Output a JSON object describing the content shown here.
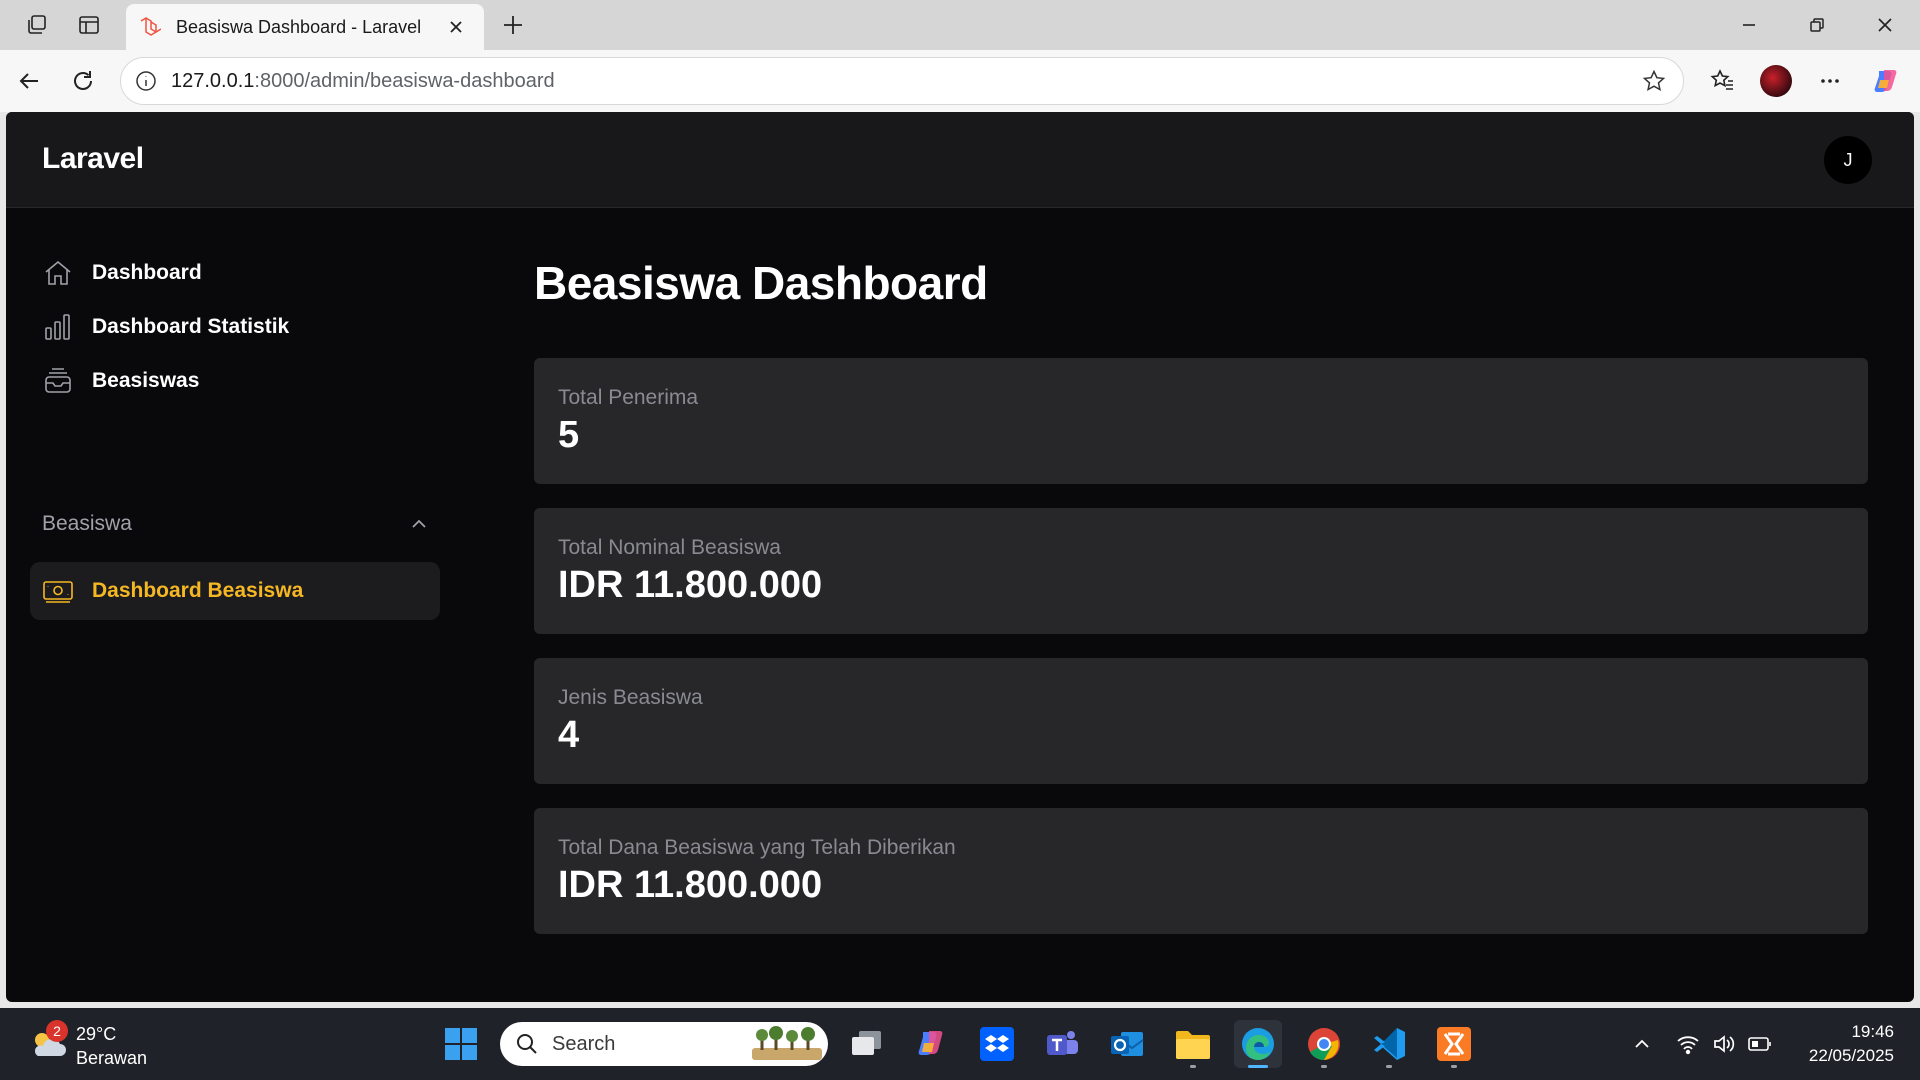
{
  "browser": {
    "tab_title": "Beasiswa Dashboard - Laravel",
    "url_host": "127.0.0.1",
    "url_rest": ":8000/admin/beasiswa-dashboard"
  },
  "app": {
    "brand": "Laravel",
    "avatar_initial": "J"
  },
  "sidebar": {
    "items": [
      {
        "label": "Dashboard",
        "icon": "home-icon"
      },
      {
        "label": "Dashboard Statistik",
        "icon": "bar-chart-icon"
      },
      {
        "label": "Beasiswas",
        "icon": "inbox-stack-icon"
      }
    ],
    "group": {
      "label": "Beasiswa",
      "items": [
        {
          "label": "Dashboard Beasiswa",
          "icon": "banknotes-icon",
          "active": true
        }
      ]
    }
  },
  "main": {
    "title": "Beasiswa Dashboard",
    "stats": [
      {
        "label": "Total Penerima",
        "value": "5"
      },
      {
        "label": "Total Nominal Beasiswa",
        "value": "IDR 11.800.000"
      },
      {
        "label": "Jenis Beasiswa",
        "value": "4"
      },
      {
        "label": "Total Dana Beasiswa yang Telah Diberikan",
        "value": "IDR 11.800.000"
      }
    ]
  },
  "colors": {
    "accent": "#f5b823",
    "background": "#09090b",
    "card": "#27272a"
  },
  "taskbar": {
    "weather_badge": "2",
    "weather_temp": "29°C",
    "weather_desc": "Berawan",
    "search_placeholder": "Search",
    "time": "19:46",
    "date": "22/05/2025"
  }
}
